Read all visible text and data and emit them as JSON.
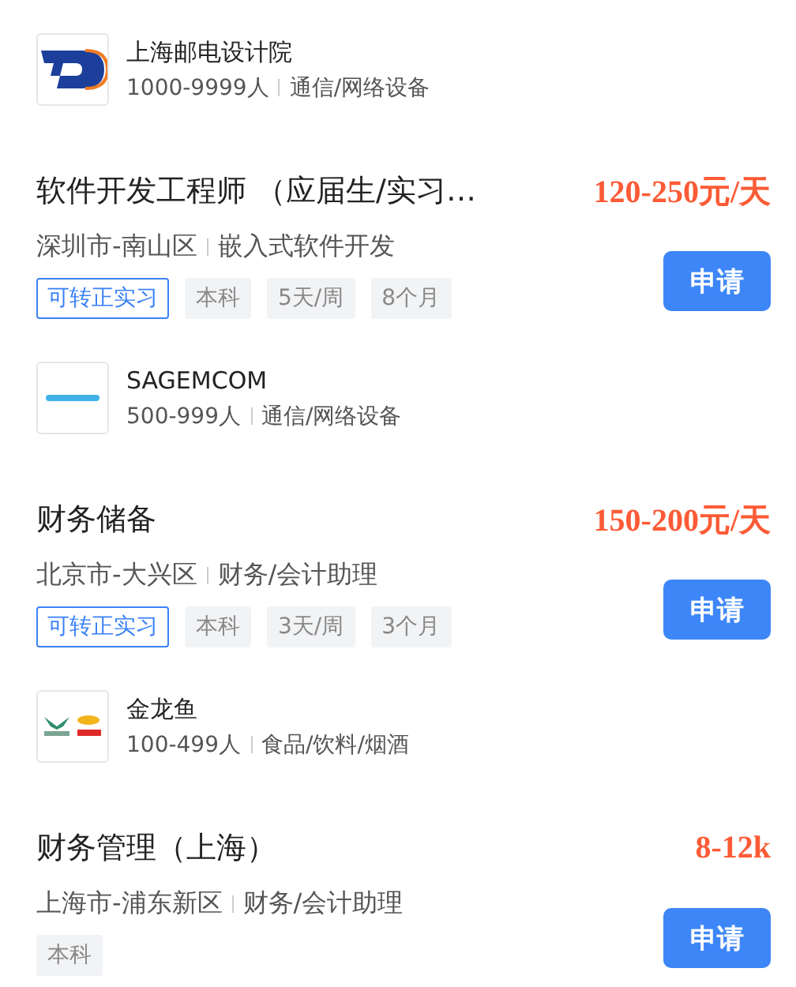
{
  "listings": [
    {
      "company": {
        "logo": {
          "kind": "d"
        },
        "name": "上海邮电设计院",
        "size": "1000-9999人",
        "industry": "通信/网络设备"
      },
      "job": {
        "title": "软件开发工程师 （应届生/实习…",
        "salary": "120-250元/天",
        "location": "深圳市-南山区",
        "category": "嵌入式软件开发",
        "tags": [
          {
            "label": "可转正实习",
            "kind": "highlight"
          },
          {
            "label": "本科",
            "kind": "plain"
          },
          {
            "label": "5天/周",
            "kind": "plain"
          },
          {
            "label": "8个月",
            "kind": "plain"
          }
        ],
        "button": "申请"
      }
    },
    {
      "company": {
        "logo": {
          "kind": "wordmark"
        },
        "name": "SAGEMCOM",
        "size": "500-999人",
        "industry": "通信/网络设备"
      },
      "job": {
        "title": "财务储备",
        "salary": "150-200元/天",
        "location": "北京市-大兴区",
        "category": "财务/会计助理",
        "tags": [
          {
            "label": "可转正实习",
            "kind": "highlight"
          },
          {
            "label": "本科",
            "kind": "plain"
          },
          {
            "label": "3天/周",
            "kind": "plain"
          },
          {
            "label": "3个月",
            "kind": "plain"
          }
        ],
        "button": "申请"
      }
    },
    {
      "company": {
        "logo": {
          "kind": "fish"
        },
        "name": "金龙鱼",
        "size": "100-499人",
        "industry": "食品/饮料/烟酒"
      },
      "job": {
        "title": "财务管理（上海）",
        "salary": "8-12k",
        "location": "上海市-浦东新区",
        "category": "财务/会计助理",
        "tags": [
          {
            "label": "本科",
            "kind": "plain"
          }
        ],
        "button": "申请"
      }
    }
  ]
}
